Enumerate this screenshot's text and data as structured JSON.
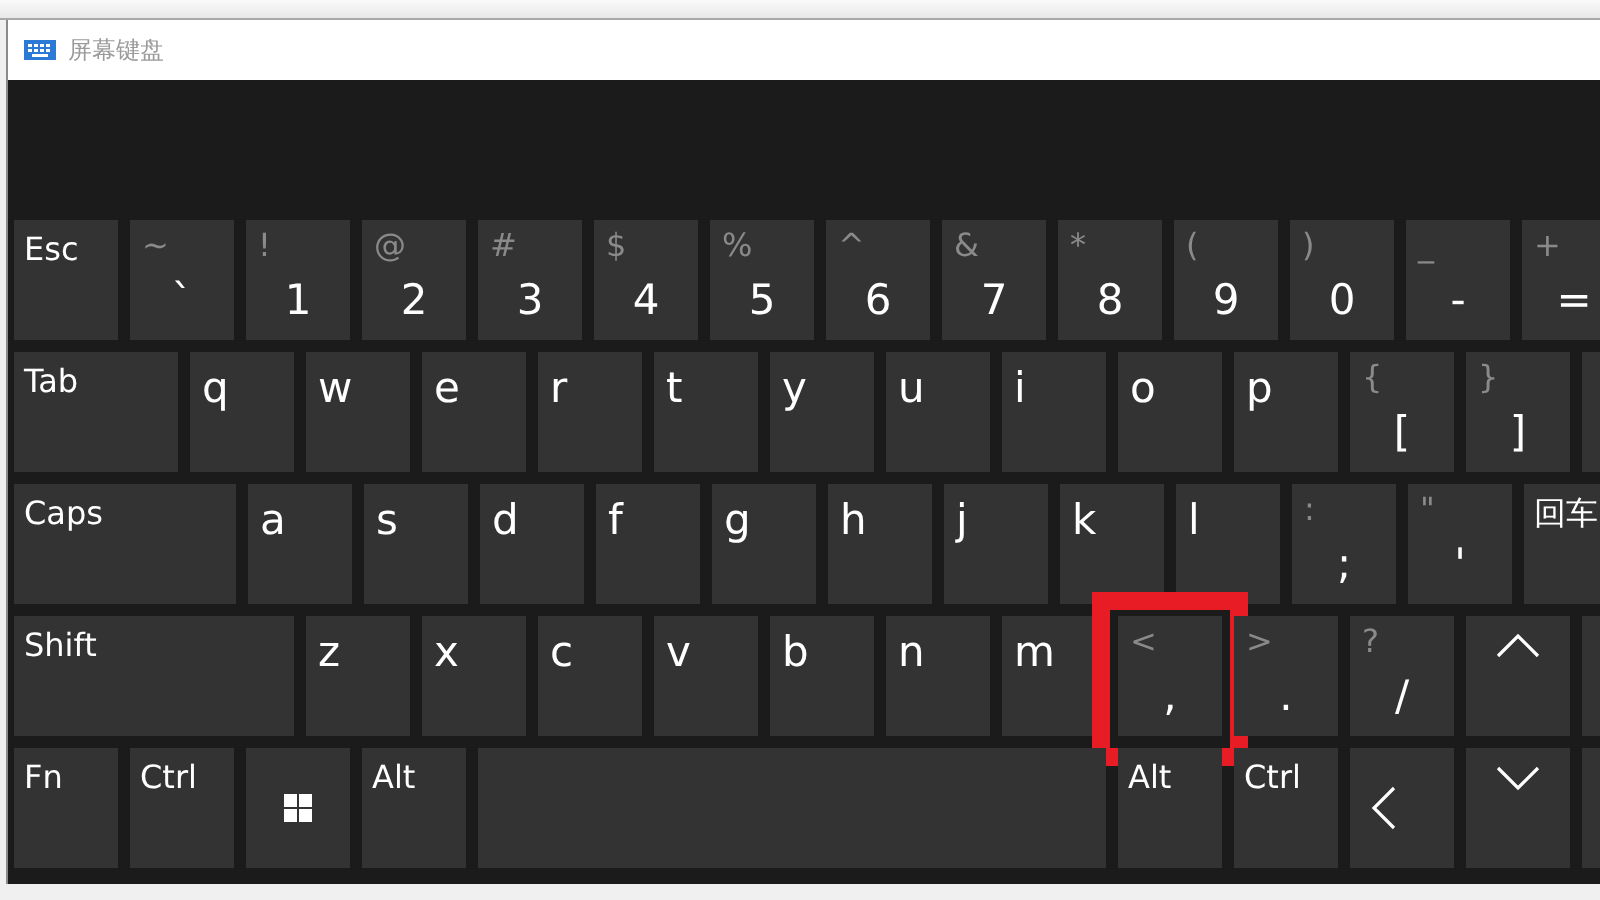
{
  "window": {
    "title": "屏幕键盘"
  },
  "rows": [
    [
      {
        "kind": "mod",
        "label": "Esc",
        "highlighted": false
      },
      {
        "kind": "char",
        "shift": "~",
        "main": "`",
        "highlighted": false
      },
      {
        "kind": "char",
        "shift": "!",
        "main": "1",
        "highlighted": false
      },
      {
        "kind": "char",
        "shift": "@",
        "main": "2",
        "highlighted": false
      },
      {
        "kind": "char",
        "shift": "#",
        "main": "3",
        "highlighted": false
      },
      {
        "kind": "char",
        "shift": "$",
        "main": "4",
        "highlighted": false
      },
      {
        "kind": "char",
        "shift": "%",
        "main": "5",
        "highlighted": false
      },
      {
        "kind": "char",
        "shift": "^",
        "main": "6",
        "highlighted": false
      },
      {
        "kind": "char",
        "shift": "&",
        "main": "7",
        "highlighted": false
      },
      {
        "kind": "char",
        "shift": "*",
        "main": "8",
        "highlighted": false
      },
      {
        "kind": "char",
        "shift": "(",
        "main": "9",
        "highlighted": false
      },
      {
        "kind": "char",
        "shift": ")",
        "main": "0",
        "highlighted": false
      },
      {
        "kind": "char",
        "shift": "_",
        "main": "-",
        "highlighted": false
      },
      {
        "kind": "char",
        "shift": "+",
        "main": "=",
        "highlighted": false
      }
    ],
    [
      {
        "kind": "tab",
        "label": "Tab",
        "highlighted": false
      },
      {
        "kind": "letter",
        "main": "q",
        "highlighted": false
      },
      {
        "kind": "letter",
        "main": "w",
        "highlighted": false
      },
      {
        "kind": "letter",
        "main": "e",
        "highlighted": false
      },
      {
        "kind": "letter",
        "main": "r",
        "highlighted": false
      },
      {
        "kind": "letter",
        "main": "t",
        "highlighted": false
      },
      {
        "kind": "letter",
        "main": "y",
        "highlighted": false
      },
      {
        "kind": "letter",
        "main": "u",
        "highlighted": false
      },
      {
        "kind": "letter",
        "main": "i",
        "highlighted": false
      },
      {
        "kind": "letter",
        "main": "o",
        "highlighted": false
      },
      {
        "kind": "letter",
        "main": "p",
        "highlighted": false
      },
      {
        "kind": "char",
        "shift": "{",
        "main": "[",
        "highlighted": false
      },
      {
        "kind": "char",
        "shift": "}",
        "main": "]",
        "highlighted": false
      },
      {
        "kind": "blank",
        "highlighted": false
      }
    ],
    [
      {
        "kind": "caps",
        "label": "Caps",
        "highlighted": false
      },
      {
        "kind": "letter",
        "main": "a",
        "highlighted": false
      },
      {
        "kind": "letter",
        "main": "s",
        "highlighted": false
      },
      {
        "kind": "letter",
        "main": "d",
        "highlighted": false
      },
      {
        "kind": "letter",
        "main": "f",
        "highlighted": false
      },
      {
        "kind": "letter",
        "main": "g",
        "highlighted": false
      },
      {
        "kind": "letter",
        "main": "h",
        "highlighted": false
      },
      {
        "kind": "letter",
        "main": "j",
        "highlighted": false
      },
      {
        "kind": "letter",
        "main": "k",
        "highlighted": false
      },
      {
        "kind": "letter",
        "main": "l",
        "highlighted": false
      },
      {
        "kind": "char",
        "shift": ":",
        "main": ";",
        "highlighted": false
      },
      {
        "kind": "char",
        "shift": "\"",
        "main": "'",
        "highlighted": false
      },
      {
        "kind": "mod",
        "label": "回车",
        "highlighted": false
      }
    ],
    [
      {
        "kind": "shift",
        "label": "Shift",
        "highlighted": false
      },
      {
        "kind": "letter",
        "main": "z",
        "highlighted": false
      },
      {
        "kind": "letter",
        "main": "x",
        "highlighted": false
      },
      {
        "kind": "letter",
        "main": "c",
        "highlighted": false
      },
      {
        "kind": "letter",
        "main": "v",
        "highlighted": false
      },
      {
        "kind": "letter",
        "main": "b",
        "highlighted": false
      },
      {
        "kind": "letter",
        "main": "n",
        "highlighted": false
      },
      {
        "kind": "letter",
        "main": "m",
        "highlighted": false
      },
      {
        "kind": "char",
        "shift": "<",
        "main": ",",
        "highlighted": true
      },
      {
        "kind": "char",
        "shift": ">",
        "main": ".",
        "highlighted": false
      },
      {
        "kind": "char",
        "shift": "?",
        "main": "/",
        "highlighted": false
      },
      {
        "kind": "arrow-up",
        "highlighted": false
      },
      {
        "kind": "blank",
        "highlighted": false
      }
    ],
    [
      {
        "kind": "mod",
        "label": "Fn",
        "highlighted": false
      },
      {
        "kind": "mod",
        "label": "Ctrl",
        "highlighted": false
      },
      {
        "kind": "win",
        "highlighted": false
      },
      {
        "kind": "mod",
        "label": "Alt",
        "highlighted": false
      },
      {
        "kind": "space",
        "highlighted": false
      },
      {
        "kind": "mod",
        "label": "Alt",
        "highlighted": false
      },
      {
        "kind": "mod",
        "label": "Ctrl",
        "highlighted": false
      },
      {
        "kind": "arrow-left",
        "highlighted": false
      },
      {
        "kind": "arrow-down",
        "highlighted": false
      },
      {
        "kind": "blank",
        "highlighted": false
      }
    ]
  ]
}
